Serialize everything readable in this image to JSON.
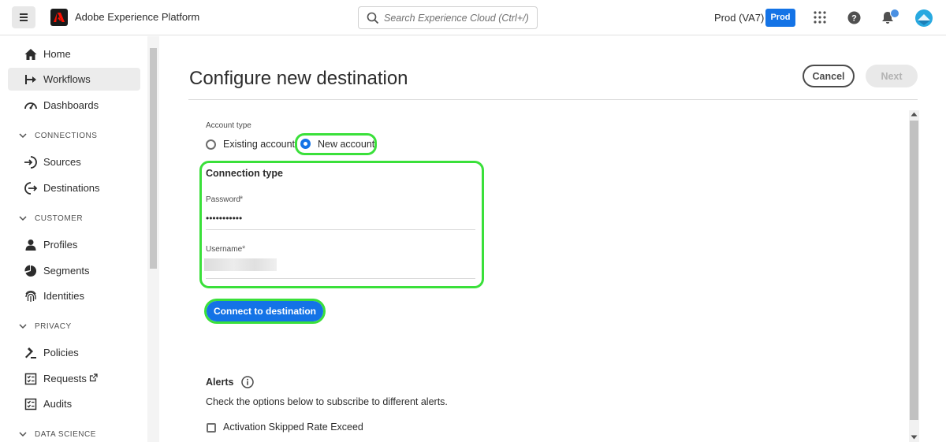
{
  "header": {
    "app_title": "Adobe Experience Platform",
    "search_placeholder": "Search Experience Cloud (Ctrl+/)",
    "org_name": "Prod (VA7)",
    "sandbox_badge": "Prod",
    "brand_color": "#1473e6",
    "icons": [
      "menu-icon",
      "adobe-logo-icon",
      "search-icon",
      "apps-grid-icon",
      "help-icon",
      "notifications-bell-icon",
      "user-avatar-icon"
    ]
  },
  "sidebar": {
    "home": "Home",
    "workflows": "Workflows",
    "dashboards": "Dashboards",
    "section_connections": "CONNECTIONS",
    "sources": "Sources",
    "destinations": "Destinations",
    "section_customer": "CUSTOMER",
    "profiles": "Profiles",
    "segments": "Segments",
    "identities": "Identities",
    "section_privacy": "PRIVACY",
    "policies": "Policies",
    "requests": "Requests",
    "audits": "Audits",
    "section_data_science": "DATA SCIENCE",
    "active_item": "Workflows"
  },
  "main": {
    "title": "Configure new destination",
    "cancel_label": "Cancel",
    "next_label": "Next",
    "account_type_label": "Account type",
    "existing_account_label": "Existing account",
    "new_account_label": "New account",
    "selected_account_type": "New account",
    "connection_type_title": "Connection type",
    "password_label": "Password",
    "password_value": "•••••••••••",
    "username_label": "Username",
    "required_marker": "*",
    "connect_button_label": "Connect to destination",
    "alerts_title": "Alerts",
    "alerts_description": "Check the options below to subscribe to different alerts.",
    "alert_option_1": "Activation Skipped Rate Exceed",
    "highlight_color": "#3ae03a"
  }
}
